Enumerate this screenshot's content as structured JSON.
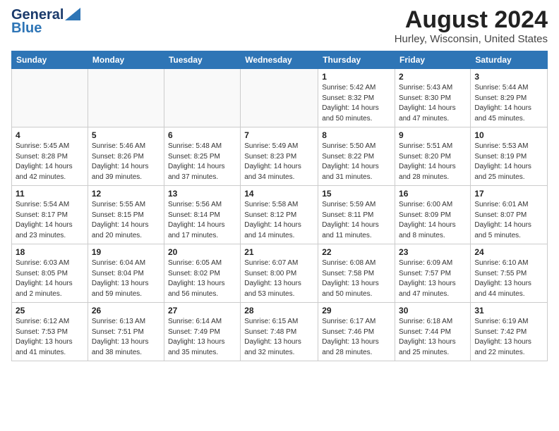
{
  "header": {
    "logo_line1": "General",
    "logo_line2": "Blue",
    "month_title": "August 2024",
    "location": "Hurley, Wisconsin, United States"
  },
  "days_of_week": [
    "Sunday",
    "Monday",
    "Tuesday",
    "Wednesday",
    "Thursday",
    "Friday",
    "Saturday"
  ],
  "weeks": [
    [
      {
        "day": "",
        "info": ""
      },
      {
        "day": "",
        "info": ""
      },
      {
        "day": "",
        "info": ""
      },
      {
        "day": "",
        "info": ""
      },
      {
        "day": "1",
        "info": "Sunrise: 5:42 AM\nSunset: 8:32 PM\nDaylight: 14 hours\nand 50 minutes."
      },
      {
        "day": "2",
        "info": "Sunrise: 5:43 AM\nSunset: 8:30 PM\nDaylight: 14 hours\nand 47 minutes."
      },
      {
        "day": "3",
        "info": "Sunrise: 5:44 AM\nSunset: 8:29 PM\nDaylight: 14 hours\nand 45 minutes."
      }
    ],
    [
      {
        "day": "4",
        "info": "Sunrise: 5:45 AM\nSunset: 8:28 PM\nDaylight: 14 hours\nand 42 minutes."
      },
      {
        "day": "5",
        "info": "Sunrise: 5:46 AM\nSunset: 8:26 PM\nDaylight: 14 hours\nand 39 minutes."
      },
      {
        "day": "6",
        "info": "Sunrise: 5:48 AM\nSunset: 8:25 PM\nDaylight: 14 hours\nand 37 minutes."
      },
      {
        "day": "7",
        "info": "Sunrise: 5:49 AM\nSunset: 8:23 PM\nDaylight: 14 hours\nand 34 minutes."
      },
      {
        "day": "8",
        "info": "Sunrise: 5:50 AM\nSunset: 8:22 PM\nDaylight: 14 hours\nand 31 minutes."
      },
      {
        "day": "9",
        "info": "Sunrise: 5:51 AM\nSunset: 8:20 PM\nDaylight: 14 hours\nand 28 minutes."
      },
      {
        "day": "10",
        "info": "Sunrise: 5:53 AM\nSunset: 8:19 PM\nDaylight: 14 hours\nand 25 minutes."
      }
    ],
    [
      {
        "day": "11",
        "info": "Sunrise: 5:54 AM\nSunset: 8:17 PM\nDaylight: 14 hours\nand 23 minutes."
      },
      {
        "day": "12",
        "info": "Sunrise: 5:55 AM\nSunset: 8:15 PM\nDaylight: 14 hours\nand 20 minutes."
      },
      {
        "day": "13",
        "info": "Sunrise: 5:56 AM\nSunset: 8:14 PM\nDaylight: 14 hours\nand 17 minutes."
      },
      {
        "day": "14",
        "info": "Sunrise: 5:58 AM\nSunset: 8:12 PM\nDaylight: 14 hours\nand 14 minutes."
      },
      {
        "day": "15",
        "info": "Sunrise: 5:59 AM\nSunset: 8:11 PM\nDaylight: 14 hours\nand 11 minutes."
      },
      {
        "day": "16",
        "info": "Sunrise: 6:00 AM\nSunset: 8:09 PM\nDaylight: 14 hours\nand 8 minutes."
      },
      {
        "day": "17",
        "info": "Sunrise: 6:01 AM\nSunset: 8:07 PM\nDaylight: 14 hours\nand 5 minutes."
      }
    ],
    [
      {
        "day": "18",
        "info": "Sunrise: 6:03 AM\nSunset: 8:05 PM\nDaylight: 14 hours\nand 2 minutes."
      },
      {
        "day": "19",
        "info": "Sunrise: 6:04 AM\nSunset: 8:04 PM\nDaylight: 13 hours\nand 59 minutes."
      },
      {
        "day": "20",
        "info": "Sunrise: 6:05 AM\nSunset: 8:02 PM\nDaylight: 13 hours\nand 56 minutes."
      },
      {
        "day": "21",
        "info": "Sunrise: 6:07 AM\nSunset: 8:00 PM\nDaylight: 13 hours\nand 53 minutes."
      },
      {
        "day": "22",
        "info": "Sunrise: 6:08 AM\nSunset: 7:58 PM\nDaylight: 13 hours\nand 50 minutes."
      },
      {
        "day": "23",
        "info": "Sunrise: 6:09 AM\nSunset: 7:57 PM\nDaylight: 13 hours\nand 47 minutes."
      },
      {
        "day": "24",
        "info": "Sunrise: 6:10 AM\nSunset: 7:55 PM\nDaylight: 13 hours\nand 44 minutes."
      }
    ],
    [
      {
        "day": "25",
        "info": "Sunrise: 6:12 AM\nSunset: 7:53 PM\nDaylight: 13 hours\nand 41 minutes."
      },
      {
        "day": "26",
        "info": "Sunrise: 6:13 AM\nSunset: 7:51 PM\nDaylight: 13 hours\nand 38 minutes."
      },
      {
        "day": "27",
        "info": "Sunrise: 6:14 AM\nSunset: 7:49 PM\nDaylight: 13 hours\nand 35 minutes."
      },
      {
        "day": "28",
        "info": "Sunrise: 6:15 AM\nSunset: 7:48 PM\nDaylight: 13 hours\nand 32 minutes."
      },
      {
        "day": "29",
        "info": "Sunrise: 6:17 AM\nSunset: 7:46 PM\nDaylight: 13 hours\nand 28 minutes."
      },
      {
        "day": "30",
        "info": "Sunrise: 6:18 AM\nSunset: 7:44 PM\nDaylight: 13 hours\nand 25 minutes."
      },
      {
        "day": "31",
        "info": "Sunrise: 6:19 AM\nSunset: 7:42 PM\nDaylight: 13 hours\nand 22 minutes."
      }
    ]
  ]
}
